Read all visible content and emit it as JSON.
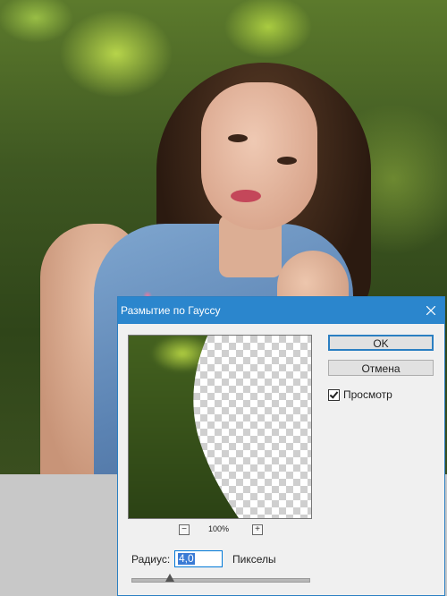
{
  "dialog": {
    "title": "Размытие по Гауссу",
    "ok_label": "OK",
    "cancel_label": "Отмена",
    "preview_label": "Просмотр",
    "preview_checked": true,
    "zoom": {
      "minus": "−",
      "level": "100%",
      "plus": "+"
    },
    "radius_label": "Радиус:",
    "radius_value": "4,0",
    "radius_units": "Пикселы",
    "slider_icon": "slider-thumb",
    "close_icon": "close-icon"
  },
  "colors": {
    "titlebar": "#2b86cd",
    "dialog_bg": "#f0f0f0",
    "selection": "#3a7bd5"
  }
}
